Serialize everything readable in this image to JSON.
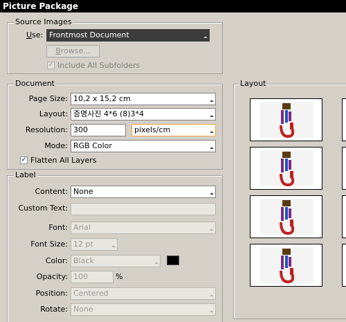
{
  "window": {
    "title": "Picture Package"
  },
  "source": {
    "legend": "Source Images",
    "use_label_pre": "",
    "use_label_u": "U",
    "use_label_post": "se:",
    "use_value": "Frontmost Document",
    "browse_label_u": "B",
    "browse_label_post": "rowse...",
    "include_subfolders": "Include All Subfolders",
    "include_checked": true
  },
  "document": {
    "legend": "Document",
    "page_size_label": "Page Size:",
    "page_size_value": "10,2 x 15,2 cm",
    "layout_label": "Layout:",
    "layout_value": "증명사진 4*6 (8)3*4",
    "resolution_label": "Resolution:",
    "resolution_value": "300",
    "resolution_unit": "pixels/cm",
    "mode_label": "Mode:",
    "mode_value": "RGB Color",
    "flatten_label": "Flatten All Layers",
    "flatten_checked": true
  },
  "label": {
    "legend": "Label",
    "content_label": "Content:",
    "content_value": "None",
    "custom_text_label": "Custom Text:",
    "custom_text_value": "",
    "font_label": "Font:",
    "font_value": "Arial",
    "font_size_label": "Font Size:",
    "font_size_value": "12 pt",
    "color_label": "Color:",
    "color_value": "Black",
    "color_swatch": "#000000",
    "opacity_label": "Opacity:",
    "opacity_value": "100",
    "opacity_unit": "%",
    "position_label": "Position:",
    "position_value": "Centered",
    "rotate_label": "Rotate:",
    "rotate_value": "None"
  },
  "layout_panel": {
    "legend": "Layout",
    "thumbnail_count": 4,
    "thumb_colors": {
      "brown": "#5a3a10",
      "purple": "#7a2a8a",
      "blue": "#2050c0",
      "red": "#c02020"
    }
  }
}
